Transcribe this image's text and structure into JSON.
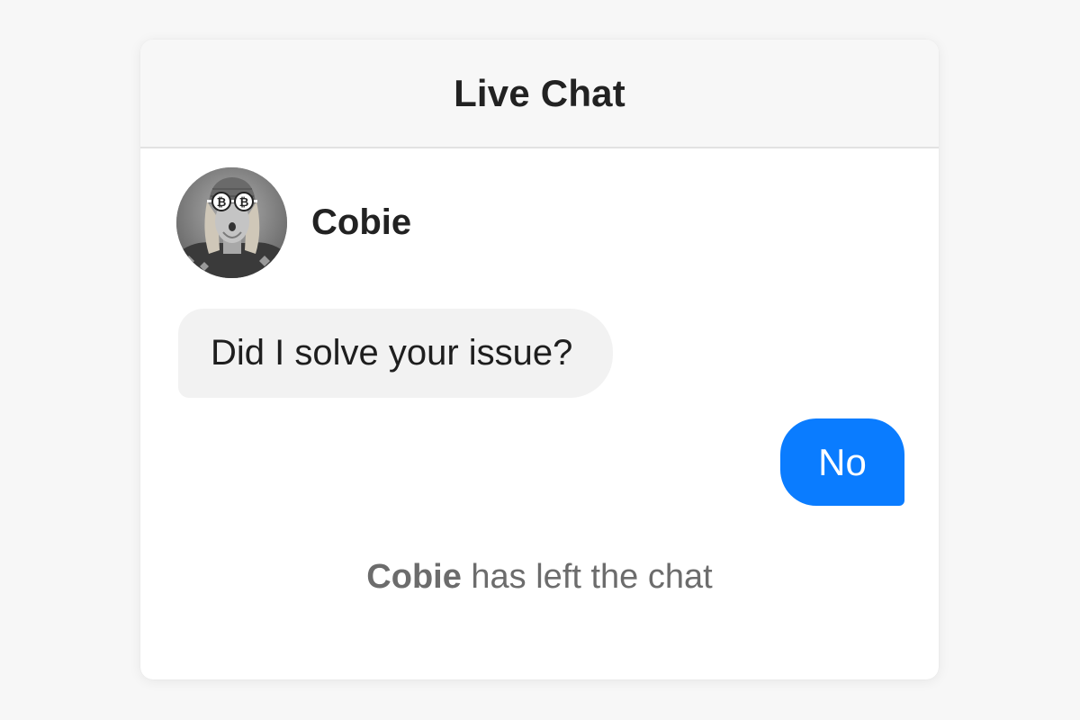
{
  "header": {
    "title": "Live Chat"
  },
  "agent": {
    "name": "Cobie",
    "avatar_icon": "user-avatar-photo"
  },
  "messages": [
    {
      "from": "agent",
      "text": "Did I solve your issue?"
    },
    {
      "from": "user",
      "text": "No"
    }
  ],
  "system": {
    "name": "Cobie",
    "text": " has left the chat"
  },
  "colors": {
    "background": "#f7f7f7",
    "header_background": "#f7f7f7",
    "incoming_bubble": "#f2f2f2",
    "outgoing_bubble": "#0a7cff",
    "system_text": "#6c6c6c"
  }
}
